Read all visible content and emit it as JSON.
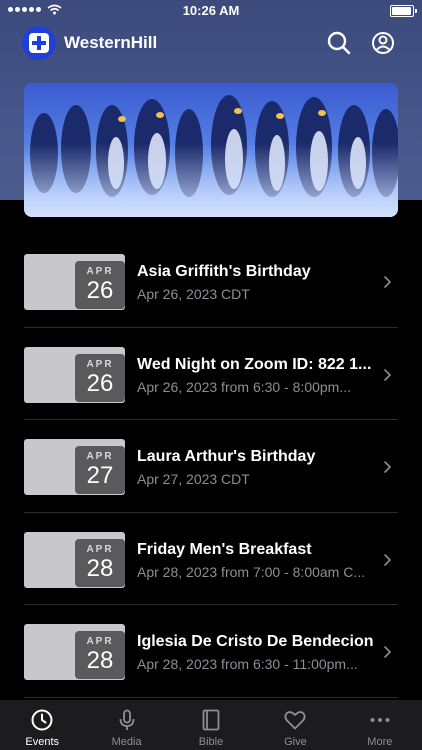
{
  "status_bar": {
    "time": "10:26 AM",
    "battery_level": 0.95
  },
  "header": {
    "app_name": "WesternHill",
    "search_icon": "search-icon",
    "account_icon": "account-circle-icon",
    "logo_icon": "church-cross-icon"
  },
  "hero": {
    "image": "emperor-penguins-photo"
  },
  "events": [
    {
      "month": "APR",
      "day": "26",
      "title": "Asia Griffith's Birthday",
      "subtitle": "Apr 26, 2023 CDT"
    },
    {
      "month": "APR",
      "day": "26",
      "title": "Wed Night on Zoom ID: 822 1...",
      "subtitle": "Apr 26, 2023 from 6:30 - 8:00pm..."
    },
    {
      "month": "APR",
      "day": "27",
      "title": "Laura Arthur's Birthday",
      "subtitle": "Apr 27, 2023 CDT"
    },
    {
      "month": "APR",
      "day": "28",
      "title": "Friday Men's Breakfast",
      "subtitle": "Apr 28, 2023 from 7:00 - 8:00am C..."
    },
    {
      "month": "APR",
      "day": "28",
      "title": "Iglesia De Cristo De Bendecion",
      "subtitle": "Apr 28, 2023 from 6:30 - 11:00pm..."
    }
  ],
  "tabs": [
    {
      "label": "Events",
      "icon": "clock-icon",
      "active": true
    },
    {
      "label": "Media",
      "icon": "microphone-icon",
      "active": false
    },
    {
      "label": "Bible",
      "icon": "book-icon",
      "active": false
    },
    {
      "label": "Give",
      "icon": "heart-icon",
      "active": false
    },
    {
      "label": "More",
      "icon": "more-dots-icon",
      "active": false
    }
  ],
  "colors": {
    "accent": "#1e3fd8",
    "header_bg": "#46568a",
    "background": "#000000",
    "tab_bar": "#1c1c1e"
  }
}
